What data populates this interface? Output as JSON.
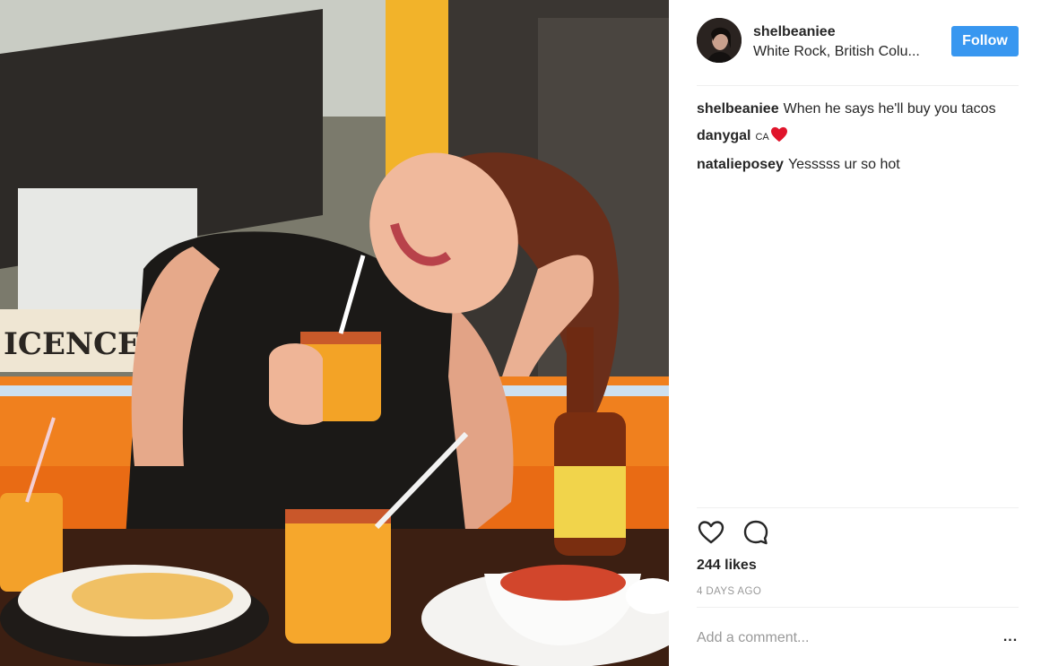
{
  "post": {
    "photo_alt": "photo",
    "author": {
      "username": "shelbeaniee",
      "location": "White Rock, British Colu..."
    },
    "follow_label": "Follow",
    "comments": [
      {
        "user": "shelbeaniee",
        "text": "When he says he'll buy you tacos"
      },
      {
        "user": "danygal",
        "text": "CA",
        "emoji": "red-heart-icon"
      },
      {
        "user": "natalieposey",
        "text": "Yesssss ur so hot"
      }
    ],
    "likes": "244 likes",
    "time": "4 DAYS AGO",
    "add_comment_placeholder": "Add a comment...",
    "more_label": "..."
  },
  "colors": {
    "follow_button": "#3897f0",
    "text": "#262626",
    "muted": "#999999",
    "divider": "#efefef"
  },
  "icons": [
    "heart-icon",
    "comment-bubble-icon",
    "more-options-icon"
  ]
}
